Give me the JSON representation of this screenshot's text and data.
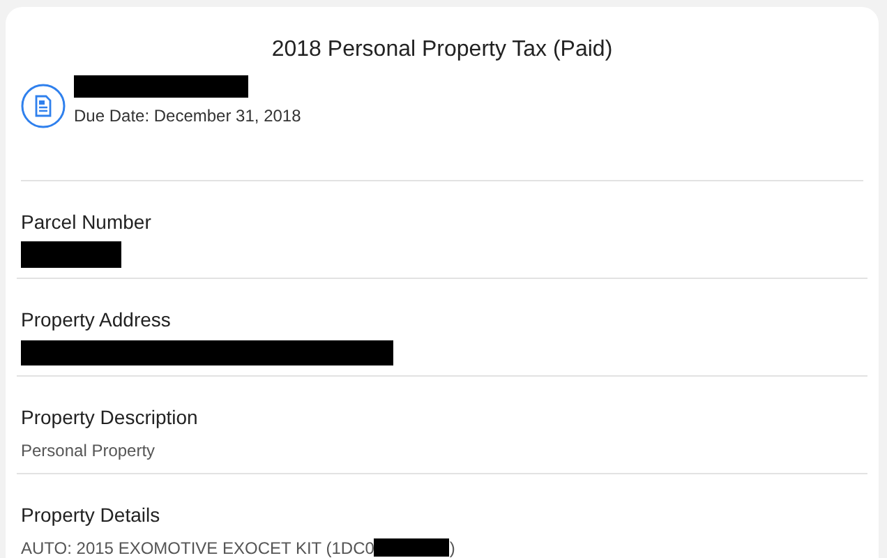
{
  "title": "2018 Personal Property Tax (Paid)",
  "bill": {
    "name": [
      {
        "kind": "redacted"
      }
    ],
    "due_date": "Due Date: December 31, 2018"
  },
  "sections": [
    {
      "label": "Parcel Number",
      "value": [
        {
          "kind": "redacted"
        }
      ]
    },
    {
      "label": "Property Address",
      "value": [
        {
          "kind": "redacted"
        }
      ]
    },
    {
      "label": "Property Description",
      "value": [
        {
          "kind": "text",
          "text": "Personal Property"
        }
      ]
    },
    {
      "label": "Property Details",
      "value": [
        {
          "kind": "text",
          "text": "AUTO: 2015 EXOMOTIVE EXOCET KIT (1DC0"
        },
        {
          "kind": "redacted"
        },
        {
          "kind": "text",
          "text": ")"
        }
      ]
    }
  ]
}
